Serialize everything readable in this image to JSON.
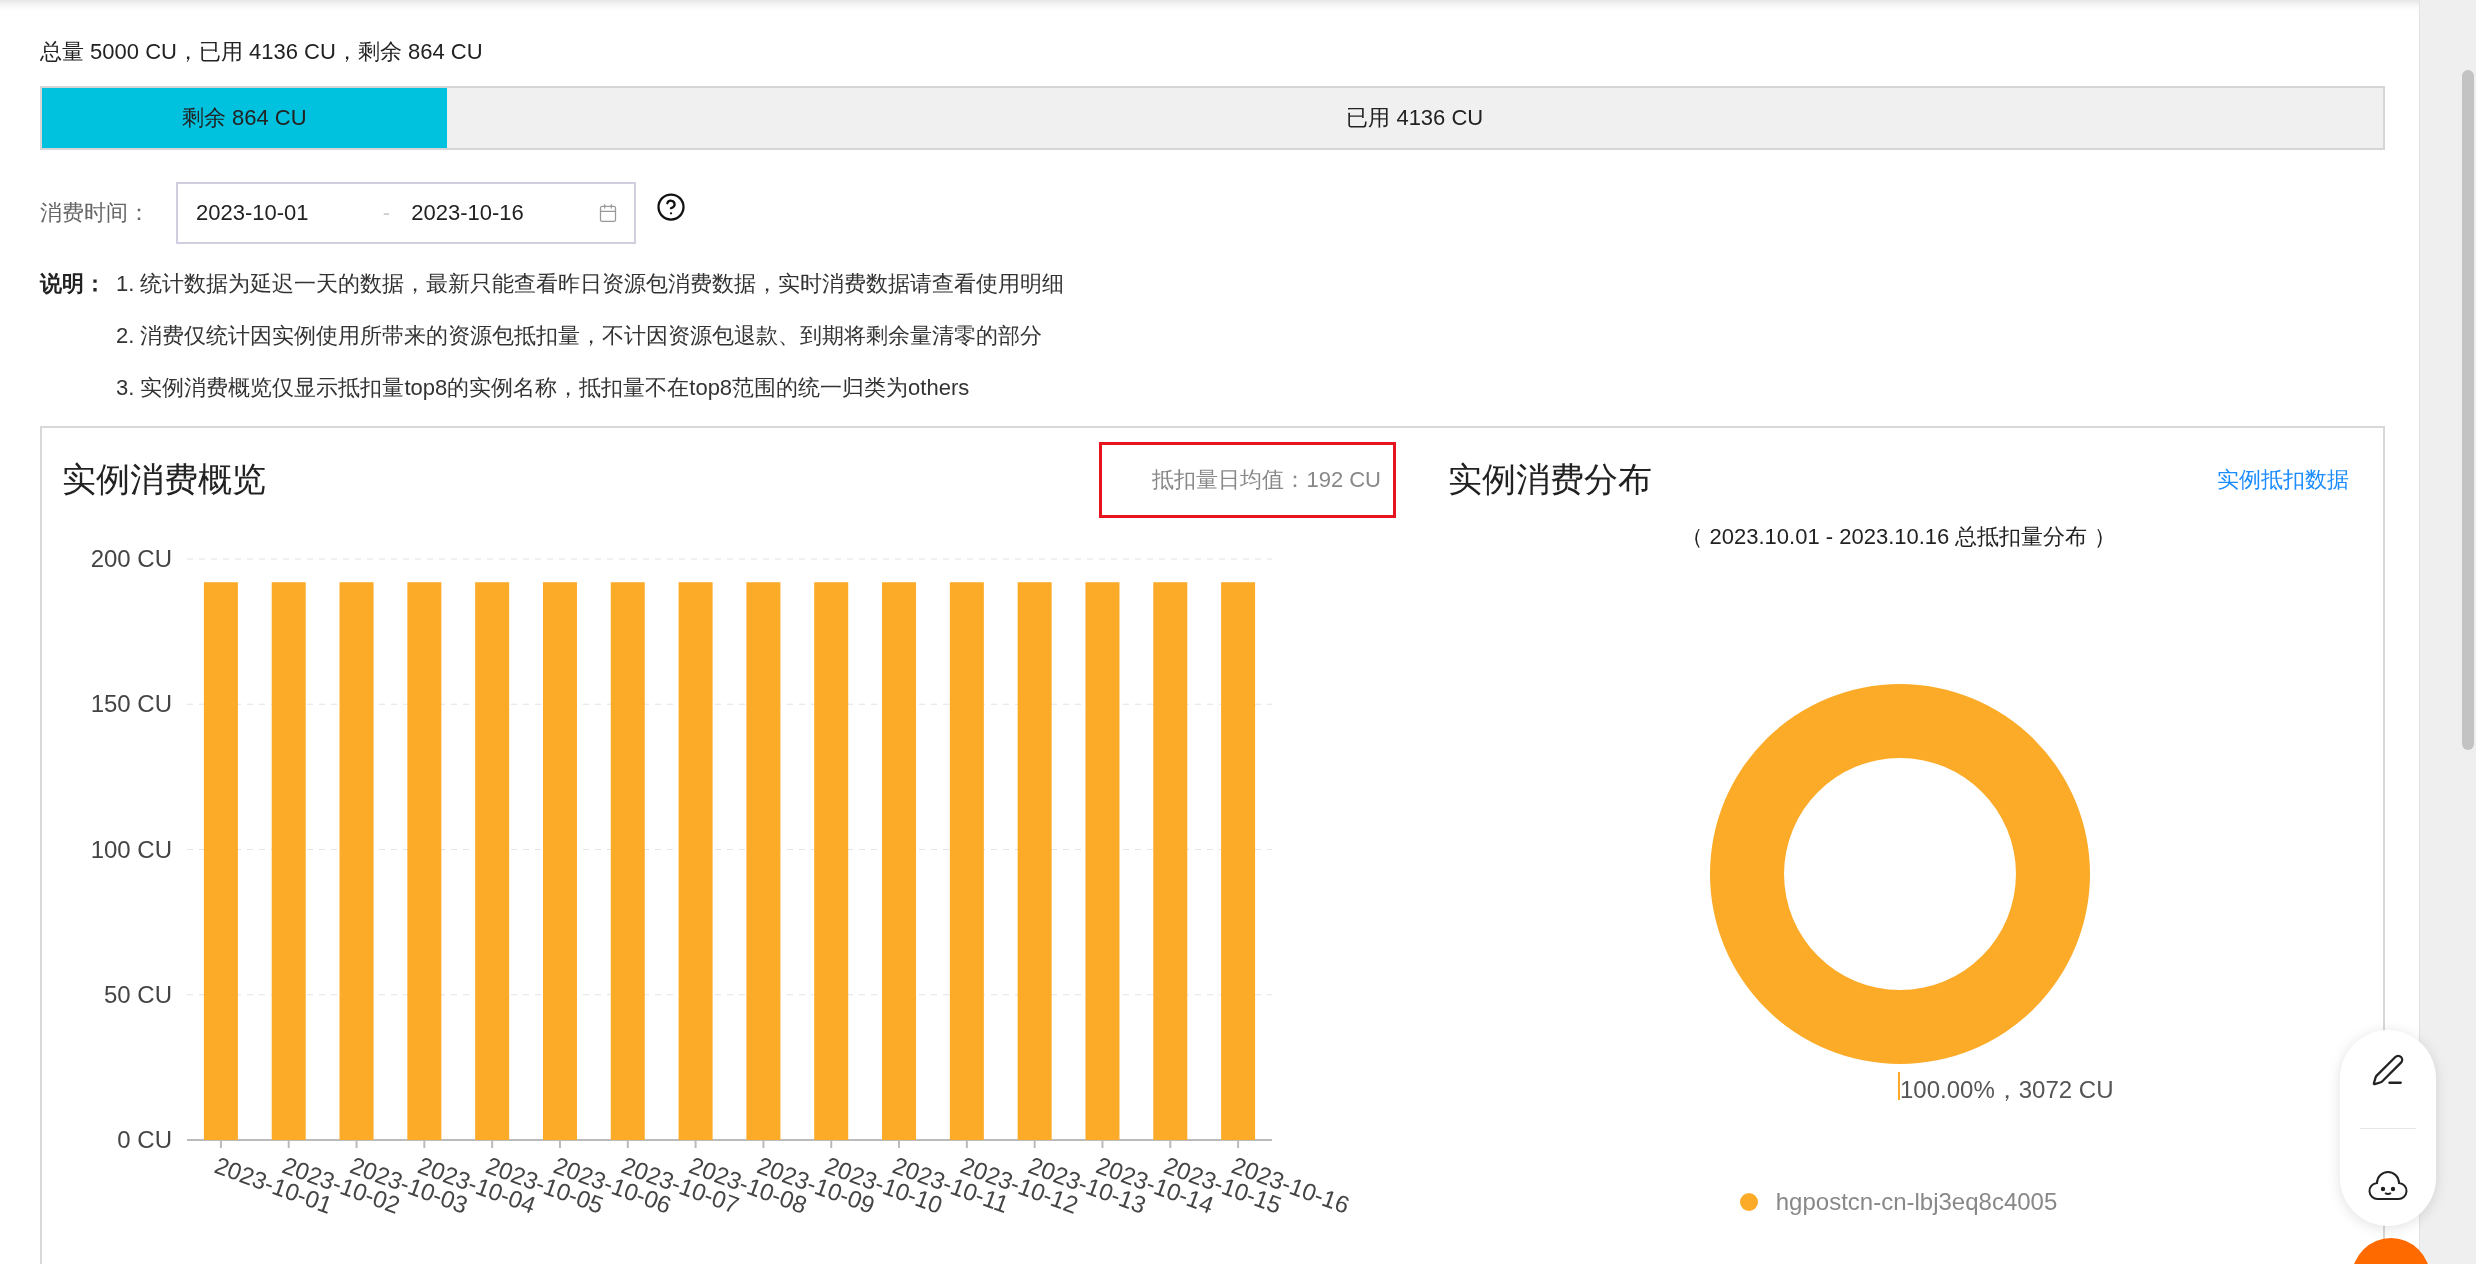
{
  "summary": "总量 5000 CU，已用 4136 CU，剩余 864 CU",
  "usage_bar": {
    "remaining_label": "剩余 864 CU",
    "used_label": "已用 4136 CU",
    "level": 0.1728
  },
  "date_filter": {
    "label": "消费时间：",
    "start": "2023-10-01",
    "separator": "-",
    "end": "2023-10-16"
  },
  "notes": {
    "label": "说明：",
    "items": [
      "1. 统计数据为延迟一天的数据，最新只能查看昨日资源包消费数据，实时消费数据请查看使用明细",
      "2. 消费仅统计因实例使用所带来的资源包抵扣量，不计因资源包退款、到期将剩余量清零的部分",
      "3. 实例消费概览仅显示抵扣量top8的实例名称，抵扣量不在top8范围的统一归类为others"
    ]
  },
  "overview": {
    "title": "实例消费概览",
    "daily_average": "抵扣量日均值：192 CU",
    "chart_data": {
      "type": "bar",
      "categories": [
        "2023-10-01",
        "2023-10-02",
        "2023-10-03",
        "2023-10-04",
        "2023-10-05",
        "2023-10-06",
        "2023-10-07",
        "2023-10-08",
        "2023-10-09",
        "2023-10-10",
        "2023-10-11",
        "2023-10-12",
        "2023-10-13",
        "2023-10-14",
        "2023-10-15",
        "2023-10-16"
      ],
      "series": [
        {
          "color": "#fcab28",
          "values": [
            192,
            192,
            192,
            192,
            192,
            192,
            192,
            192,
            192,
            192,
            192,
            192,
            192,
            192,
            192,
            192
          ]
        }
      ],
      "ylim": [
        0,
        200
      ],
      "grid": true,
      "yticks": [
        {
          "value": 0,
          "label": "0 CU"
        },
        {
          "value": 50,
          "label": "50 CU"
        },
        {
          "value": 100,
          "label": "100 CU"
        },
        {
          "value": 150,
          "label": "150 CU"
        },
        {
          "value": 200,
          "label": "200 CU"
        }
      ]
    }
  },
  "distribution": {
    "title": "实例消费分布",
    "link": "实例抵扣数据",
    "subtitle": "（ 2023.10.01 - 2023.10.16 总抵扣量分布 ）",
    "chart_data": {
      "type": "pie",
      "categories": [
        "hgpostcn-cn-lbj3eq8c4005"
      ],
      "series": [
        {
          "color": "#fcab28",
          "values": [
            100
          ]
        }
      ],
      "value_labels": [
        "100.00%，3072 CU"
      ]
    }
  }
}
